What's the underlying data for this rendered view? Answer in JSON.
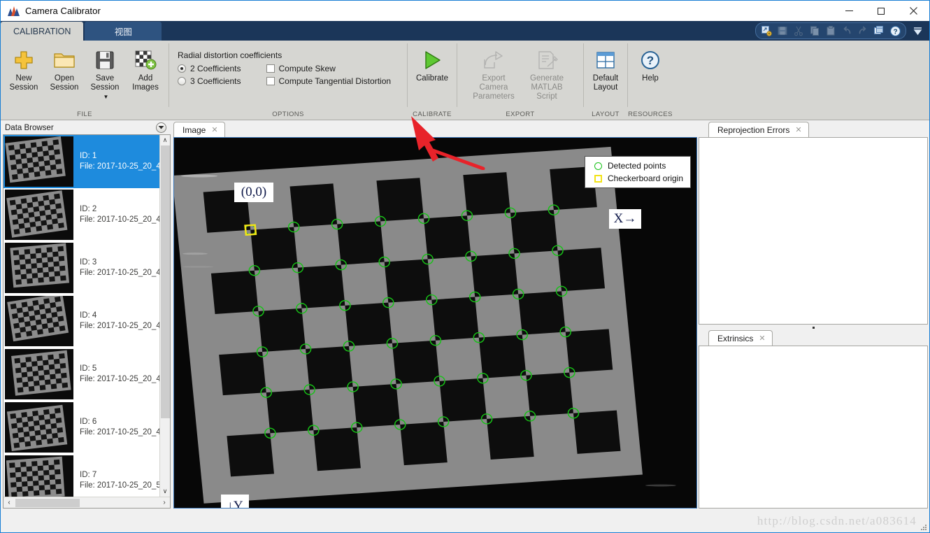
{
  "window": {
    "title": "Camera Calibrator",
    "app_icon": "matlab-icon",
    "minimize_label": "—",
    "maximize_label": "□",
    "close_label": "✕"
  },
  "ribbon": {
    "tabs": [
      {
        "label": "CALIBRATION",
        "active": true
      },
      {
        "label": "视图",
        "active": false
      }
    ],
    "quick_access": [
      {
        "name": "export-figure-icon",
        "enabled": true
      },
      {
        "name": "save-icon",
        "enabled": false
      },
      {
        "name": "cut-icon",
        "enabled": false
      },
      {
        "name": "copy-icon",
        "enabled": false
      },
      {
        "name": "paste-icon",
        "enabled": false
      },
      {
        "name": "undo-icon",
        "enabled": false
      },
      {
        "name": "redo-icon",
        "enabled": false
      },
      {
        "name": "layout-icon",
        "enabled": true
      },
      {
        "name": "help-icon",
        "enabled": true
      },
      {
        "name": "minimize-ribbon-icon",
        "enabled": true
      }
    ],
    "groups": [
      {
        "name": "file",
        "label": "FILE",
        "buttons": [
          {
            "name": "new-session-button",
            "line1": "New",
            "line2": "Session",
            "icon": "plus-icon",
            "enabled": true,
            "dropdown": false
          },
          {
            "name": "open-session-button",
            "line1": "Open",
            "line2": "Session",
            "icon": "folder-icon",
            "enabled": true,
            "dropdown": false
          },
          {
            "name": "save-session-button",
            "line1": "Save",
            "line2": "Session",
            "icon": "floppy-icon",
            "enabled": true,
            "dropdown": true
          },
          {
            "name": "add-images-button",
            "line1": "Add",
            "line2": "Images",
            "icon": "add-images-icon",
            "enabled": true,
            "dropdown": false
          }
        ]
      },
      {
        "name": "options",
        "label": "OPTIONS",
        "title": "Radial distortion coefficients",
        "radios": [
          {
            "label": "2 Coefficients",
            "checked": true
          },
          {
            "label": "3 Coefficients",
            "checked": false
          }
        ],
        "checkboxes": [
          {
            "label": "Compute Skew",
            "checked": false
          },
          {
            "label": "Compute Tangential Distortion",
            "checked": false
          }
        ]
      },
      {
        "name": "calibrate",
        "label": "CALIBRATE",
        "buttons": [
          {
            "name": "calibrate-button",
            "line1": "Calibrate",
            "line2": "",
            "icon": "play-icon",
            "enabled": true,
            "dropdown": false
          }
        ]
      },
      {
        "name": "export",
        "label": "EXPORT",
        "buttons": [
          {
            "name": "export-camera-parameters-button",
            "line1": "Export Camera",
            "line2": "Parameters",
            "icon": "export-icon",
            "enabled": false,
            "dropdown": false
          },
          {
            "name": "generate-matlab-script-button",
            "line1": "Generate",
            "line2": "MATLAB Script",
            "icon": "script-icon",
            "enabled": false,
            "dropdown": false
          }
        ]
      },
      {
        "name": "layout",
        "label": "LAYOUT",
        "buttons": [
          {
            "name": "default-layout-button",
            "line1": "Default",
            "line2": "Layout",
            "icon": "grid-layout-icon",
            "enabled": true,
            "dropdown": false
          }
        ]
      },
      {
        "name": "resources",
        "label": "RESOURCES",
        "buttons": [
          {
            "name": "help-button",
            "line1": "Help",
            "line2": "",
            "icon": "question-icon",
            "enabled": true,
            "dropdown": false
          }
        ]
      }
    ]
  },
  "data_browser": {
    "title": "Data Browser",
    "dropdown_icon": "chevron-down-circle-icon",
    "id_prefix": "ID: ",
    "file_prefix": "File: ",
    "items": [
      {
        "id": "ID: 1",
        "file": "File: 2017-10-25_20_4",
        "selected": true
      },
      {
        "id": "ID: 2",
        "file": "File: 2017-10-25_20_4",
        "selected": false
      },
      {
        "id": "ID: 3",
        "file": "File: 2017-10-25_20_4",
        "selected": false
      },
      {
        "id": "ID: 4",
        "file": "File: 2017-10-25_20_4",
        "selected": false
      },
      {
        "id": "ID: 5",
        "file": "File: 2017-10-25_20_4",
        "selected": false
      },
      {
        "id": "ID: 6",
        "file": "File: 2017-10-25_20_4",
        "selected": false
      },
      {
        "id": "ID: 7",
        "file": "File: 2017-10-25_20_5",
        "selected": false
      }
    ],
    "scroll_up_glyph": "∧",
    "scroll_down_glyph": "∨",
    "scroll_left_glyph": "‹",
    "scroll_right_glyph": "›"
  },
  "image_panel": {
    "tab_label": "Image",
    "tab_close_glyph": "✕",
    "legend": [
      {
        "glyph": "circle",
        "label": "Detected points",
        "color": "#17c217"
      },
      {
        "glyph": "square",
        "label": "Checkerboard origin",
        "color": "#f2e318"
      }
    ],
    "origin_label": "(0,0)",
    "x_axis_label": "X→",
    "y_axis_label": "↓Y"
  },
  "right_panels": [
    {
      "name": "reprojection-errors-panel",
      "tab_label": "Reprojection Errors",
      "tab_close_glyph": "✕"
    },
    {
      "name": "extrinsics-panel",
      "tab_label": "Extrinsics",
      "tab_close_glyph": "✕"
    }
  ],
  "status_bar": {
    "watermark": "http://blog.csdn.net/a083614"
  },
  "annotation": {
    "arrow_color": "#e8232a",
    "points_to": "calibrate-button"
  },
  "colors": {
    "accent_blue": "#1e8bdd",
    "ribbon_bg": "#d6d6d2",
    "tabstrip_bg": "#1b3659",
    "detected_point_green": "#17c217",
    "origin_yellow": "#f2e318",
    "arrow_red": "#e8232a"
  }
}
